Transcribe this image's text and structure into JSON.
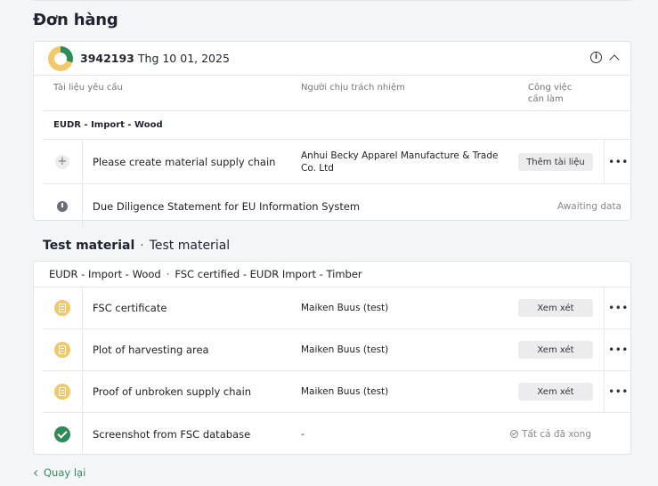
{
  "page": {
    "title": "Đơn hàng",
    "back_label": "Quay lại"
  },
  "order": {
    "id": "3942193",
    "date": "Thg 10 01, 2025",
    "progress_fraction": 0.3,
    "columns": {
      "document": "Tài liệu yêu cầu",
      "owner": "Người chịu trách nhiệm",
      "task_line1": "Công việc",
      "task_line2": "cần làm"
    },
    "group_label": "EUDR - Import - Wood",
    "rows": [
      {
        "name": "Please create material supply chain",
        "owner": "Anhui Becky Apparel Manufacture & Trade Co. Ltd",
        "action": "Thêm tài liệu",
        "icon": "plus-icon"
      },
      {
        "name": "Due Diligence Statement for EU Information System",
        "status": "Awaiting data",
        "icon": "timer-icon"
      }
    ]
  },
  "material": {
    "title_bold": "Test material",
    "title_rest": "Test material",
    "tags": [
      "EUDR - Import - Wood",
      "FSC certified - EUDR Import - Timber"
    ],
    "rows": [
      {
        "name": "FSC certificate",
        "owner": "Maiken Buus (test)",
        "action": "Xem xét",
        "icon": "document-icon"
      },
      {
        "name": "Plot of harvesting area",
        "owner": "Maiken Buus (test)",
        "action": "Xem xét",
        "icon": "document-icon"
      },
      {
        "name": "Proof of unbroken supply chain",
        "owner": "Maiken Buus (test)",
        "action": "Xem xét",
        "icon": "document-icon"
      },
      {
        "name": "Screenshot from FSC database",
        "owner": "-",
        "status": "Tất cả đã xong",
        "icon": "check-circle-icon"
      }
    ]
  },
  "colors": {
    "accent_green": "#3a8a57",
    "pending_yellow": "#f3c86a",
    "done_green": "#2e8b57"
  },
  "icons": {
    "more": "more-horizontal-icon",
    "info": "info-icon",
    "collapse": "chevron-up-icon",
    "back": "chevron-left-icon"
  },
  "more_glyph": "•••"
}
